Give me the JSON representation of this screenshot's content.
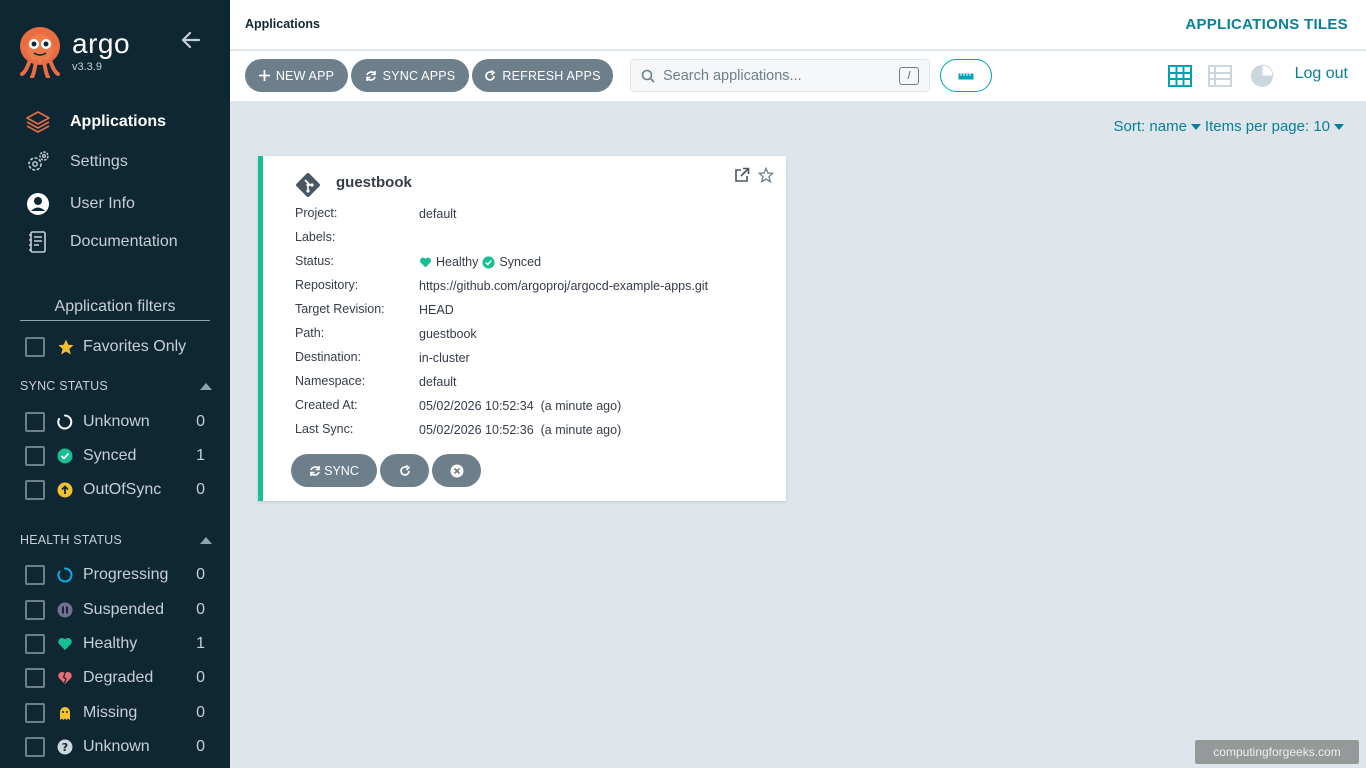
{
  "app": {
    "brand": "argo",
    "version": "v3.3.9"
  },
  "nav": [
    {
      "label": "Applications",
      "icon": "layers-icon",
      "active": true
    },
    {
      "label": "Settings",
      "icon": "gears-icon"
    },
    {
      "label": "User Info",
      "icon": "user-circle-icon"
    },
    {
      "label": "Documentation",
      "icon": "book-icon"
    }
  ],
  "filters": {
    "title": "Application filters",
    "favorites_label": "Favorites Only",
    "sync_status": {
      "title": "SYNC STATUS",
      "items": [
        {
          "label": "Unknown",
          "count": "0",
          "icon": "circle-notch-icon",
          "color": "#ffffff"
        },
        {
          "label": "Synced",
          "count": "1",
          "icon": "check-circle-icon",
          "color": "#18be94"
        },
        {
          "label": "OutOfSync",
          "count": "0",
          "icon": "arrow-up-circle-icon",
          "color": "#f4c030"
        }
      ]
    },
    "health_status": {
      "title": "HEALTH STATUS",
      "items": [
        {
          "label": "Progressing",
          "count": "0",
          "icon": "progress-circle-icon",
          "color": "#0dadea"
        },
        {
          "label": "Suspended",
          "count": "0",
          "icon": "pause-circle-icon",
          "color": "#766f94"
        },
        {
          "label": "Healthy",
          "count": "1",
          "icon": "heart-icon",
          "color": "#18be94"
        },
        {
          "label": "Degraded",
          "count": "0",
          "icon": "broken-heart-icon",
          "color": "#e96d76"
        },
        {
          "label": "Missing",
          "count": "0",
          "icon": "ghost-icon",
          "color": "#f4c030"
        },
        {
          "label": "Unknown",
          "count": "0",
          "icon": "question-circle-icon",
          "color": "#ccd6dd"
        }
      ]
    }
  },
  "header": {
    "breadcrumb": "Applications",
    "view_title": "APPLICATIONS TILES"
  },
  "toolbar": {
    "new_app": "NEW APP",
    "sync_apps": "SYNC APPS",
    "refresh_apps": "REFRESH APPS",
    "search_placeholder": "Search applications...",
    "search_shortcut": "/",
    "logout": "Log out"
  },
  "sort": {
    "sort_label": "Sort: name",
    "per_page_label": "Items per page: 10"
  },
  "application": {
    "name": "guestbook",
    "fields": [
      {
        "key": "Project:",
        "value": "default"
      },
      {
        "key": "Labels:",
        "value": ""
      },
      {
        "key": "Status:",
        "health": "Healthy",
        "sync": "Synced"
      },
      {
        "key": "Repository:",
        "value": "https://github.com/argoproj/argocd-example-apps.git"
      },
      {
        "key": "Target Revision:",
        "value": "HEAD"
      },
      {
        "key": "Path:",
        "value": "guestbook"
      },
      {
        "key": "Destination:",
        "value": "in-cluster"
      },
      {
        "key": "Namespace:",
        "value": "default"
      },
      {
        "key": "Created At:",
        "value": "05/02/2026 10:52:34  (a minute ago)"
      },
      {
        "key": "Last Sync:",
        "value": "05/02/2026 10:52:36  (a minute ago)"
      }
    ],
    "sync_button": "SYNC"
  },
  "watermark": "computingforgeeks.com",
  "colors": {
    "accent": "#0a8096",
    "sidebar_bg": "#0f2733",
    "healthy": "#18be94",
    "button_gray": "#6d7f8b"
  }
}
